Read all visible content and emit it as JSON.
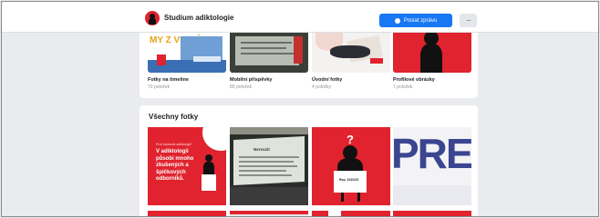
{
  "header": {
    "page_name": "Studium adiktologie",
    "send_message_label": "Poslat zprávu",
    "more_label": "···"
  },
  "albums": [
    {
      "name": "Fotky na timeline",
      "count": "70 položek",
      "thumb_text": "MY Z VIDNĚ"
    },
    {
      "name": "Mobilní příspěvky",
      "count": "80 položek"
    },
    {
      "name": "Úvodní fotky",
      "count": "4 položky"
    },
    {
      "name": "Profilové obrázky",
      "count": "7 položek"
    }
  ],
  "all_photos": {
    "title": "Všechny fotky",
    "photo1_text": "V adiktologii působí mnoho zkušených a špičkových odborníků.",
    "photo1_small": "Proč studovat adiktologii?",
    "photo2_text": "Nervozit",
    "photo3_text": "Rep. 2022/23",
    "photo4_text": "PRE"
  },
  "colors": {
    "accent_red": "#e0232e",
    "facebook_blue": "#1877f2"
  }
}
